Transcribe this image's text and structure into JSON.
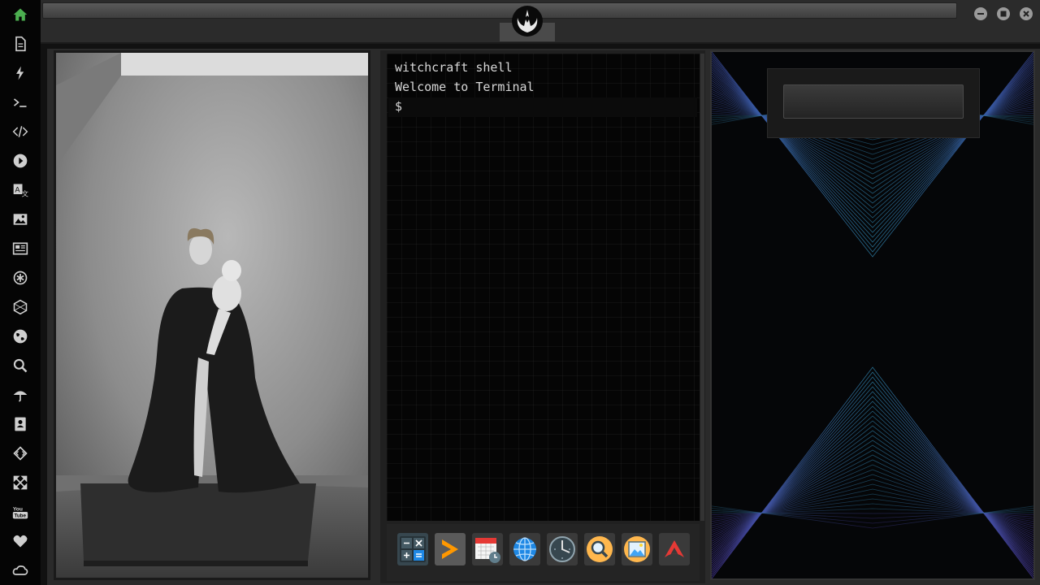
{
  "sidebar": {
    "items": [
      {
        "icon": "home-icon"
      },
      {
        "icon": "document-icon"
      },
      {
        "icon": "bolt-icon"
      },
      {
        "icon": "terminal-icon"
      },
      {
        "icon": "code-icon"
      },
      {
        "icon": "play-icon"
      },
      {
        "icon": "translate-icon"
      },
      {
        "icon": "image-icon"
      },
      {
        "icon": "news-icon"
      },
      {
        "icon": "asterisk-icon"
      },
      {
        "icon": "hexagon-icon"
      },
      {
        "icon": "globe-icon"
      },
      {
        "icon": "search-icon"
      },
      {
        "icon": "umbrella-icon"
      },
      {
        "icon": "contacts-icon"
      },
      {
        "icon": "dev-icon"
      },
      {
        "icon": "expand-icon"
      },
      {
        "icon": "youtube-icon"
      },
      {
        "icon": "heart-icon"
      },
      {
        "icon": "cloud-icon"
      }
    ],
    "active_color": "#4caf50",
    "icon_color": "#cfcfcf"
  },
  "topbar": {
    "address_value": "",
    "emblem": "rebel-alliance-icon"
  },
  "window_controls": [
    "minimize-icon",
    "maximize-icon",
    "close-icon"
  ],
  "terminal": {
    "lines": [
      "witchcraft shell",
      "Welcome to Terminal"
    ],
    "prompt": "$"
  },
  "dock": {
    "apps": [
      {
        "icon": "calculator-icon",
        "color": "#1e88e5"
      },
      {
        "icon": "sublime-icon",
        "color": "#ff9800"
      },
      {
        "icon": "calendar-icon",
        "color": "#e53935"
      },
      {
        "icon": "globe-icon",
        "color": "#2196f3"
      },
      {
        "icon": "clock-icon",
        "color": "#90a4ae"
      },
      {
        "icon": "magnifier-icon",
        "color": "#ffb74d"
      },
      {
        "icon": "photo-icon",
        "color": "#ffb74d"
      },
      {
        "icon": "arch-icon",
        "color": "#e53935"
      }
    ]
  },
  "widget": {
    "input_value": ""
  },
  "photo": {
    "icon": "mother-child-photo"
  }
}
